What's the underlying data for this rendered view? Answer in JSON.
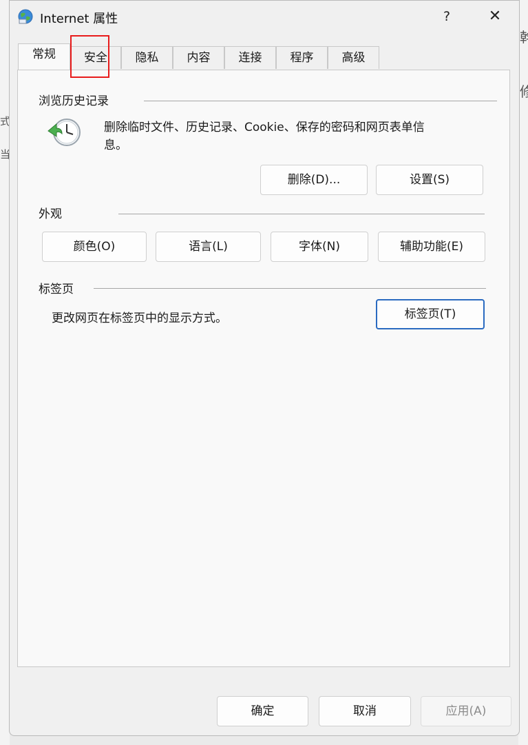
{
  "background": {
    "text_left_1": "式",
    "text_left_2": "当",
    "text_right_1": "幹",
    "text_right_2": "修"
  },
  "window": {
    "title": "Internet 属性",
    "help": "?",
    "close": "✕"
  },
  "tabs": [
    {
      "label": "常规",
      "active": true
    },
    {
      "label": "安全",
      "active": false
    },
    {
      "label": "隐私",
      "active": false
    },
    {
      "label": "内容",
      "active": false
    },
    {
      "label": "连接",
      "active": false
    },
    {
      "label": "程序",
      "active": false
    },
    {
      "label": "高级",
      "active": false
    }
  ],
  "history": {
    "group_label": "浏览历史记录",
    "description_line1": "删除临时文件、历史记录、Cookie、保存的密码和网页表单信",
    "description_line2": "息。",
    "delete_button": "删除(D)...",
    "settings_button": "设置(S)"
  },
  "appearance": {
    "group_label": "外观",
    "colors_button": "颜色(O)",
    "languages_button": "语言(L)",
    "fonts_button": "字体(N)",
    "accessibility_button": "辅助功能(E)"
  },
  "tabs_group": {
    "group_label": "标签页",
    "description": "更改网页在标签页中的显示方式。",
    "tabs_button": "标签页(T)"
  },
  "footer": {
    "ok_button": "确定",
    "cancel_button": "取消",
    "apply_button": "应用(A)"
  },
  "colors": {
    "highlight_box": "#e81a1a",
    "focus_border": "#2a6ac0"
  }
}
